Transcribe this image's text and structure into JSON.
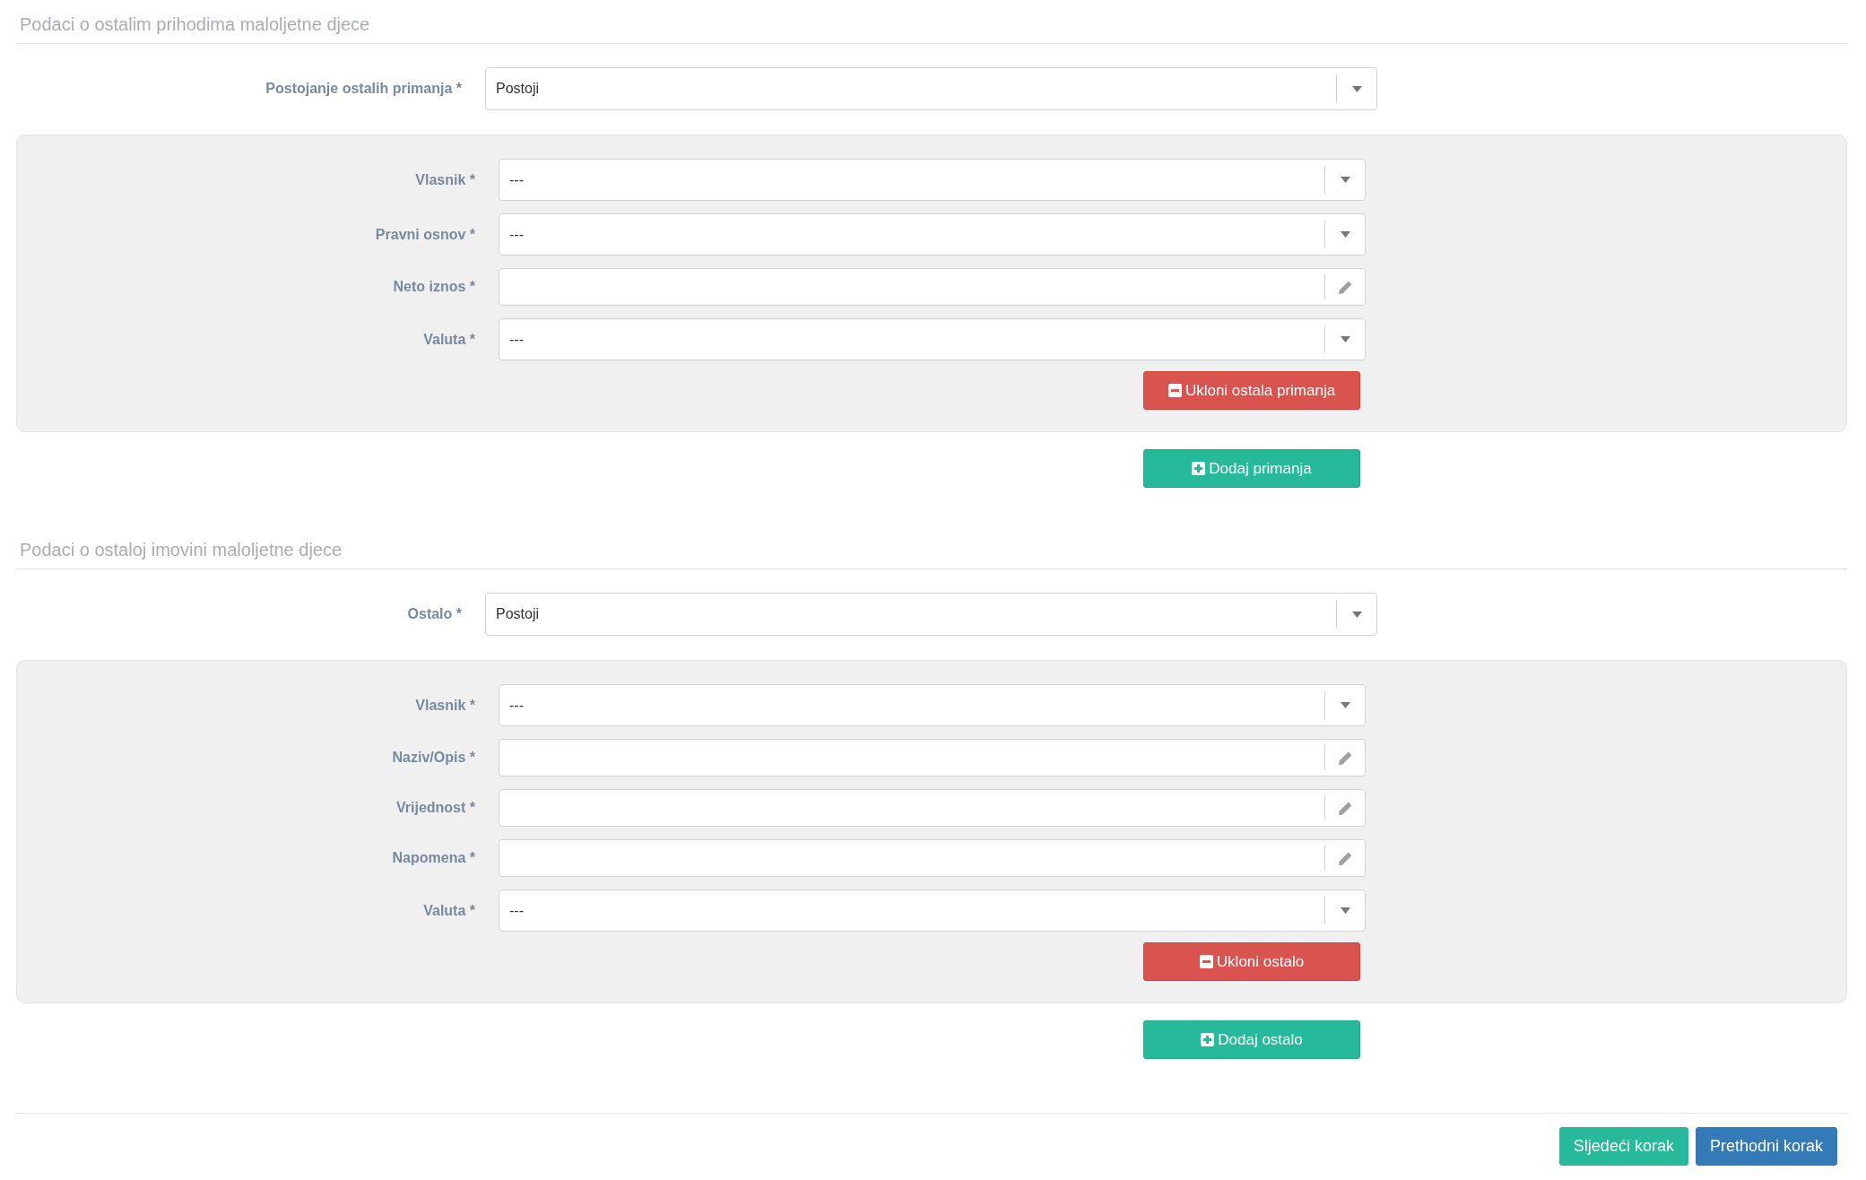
{
  "sections": [
    {
      "title": "Podaci o ostalim prihodima maloljetne djece",
      "main_field": {
        "label": "Postojanje ostalih primanja *",
        "kind": "select",
        "value": "Postoji"
      },
      "entries": [
        {
          "fields": [
            {
              "label": "Vlasnik *",
              "kind": "select",
              "value": "---"
            },
            {
              "label": "Pravni osnov *",
              "kind": "select",
              "value": "---"
            },
            {
              "label": "Neto iznos *",
              "kind": "text"
            },
            {
              "label": "Valuta *",
              "kind": "select",
              "value": "---"
            }
          ],
          "remove_button": "Ukloni ostala primanja"
        }
      ],
      "add_button": "Dodaj primanja"
    },
    {
      "title": "Podaci o ostaloj imovini maloljetne djece",
      "main_field": {
        "label": "Ostalo *",
        "kind": "select",
        "value": "Postoji"
      },
      "entries": [
        {
          "fields": [
            {
              "label": "Vlasnik *",
              "kind": "select",
              "value": "---"
            },
            {
              "label": "Naziv/Opis *",
              "kind": "text"
            },
            {
              "label": "Vrijednost *",
              "kind": "text"
            },
            {
              "label": "Napomena *",
              "kind": "text"
            },
            {
              "label": "Valuta *",
              "kind": "select",
              "value": "---"
            }
          ],
          "remove_button": "Ukloni ostalo"
        }
      ],
      "add_button": "Dodaj ostalo"
    }
  ],
  "footer_buttons": [
    {
      "label": "Sljedeći korak",
      "kind": "next"
    },
    {
      "label": "Prethodni korak",
      "kind": "previous"
    }
  ]
}
